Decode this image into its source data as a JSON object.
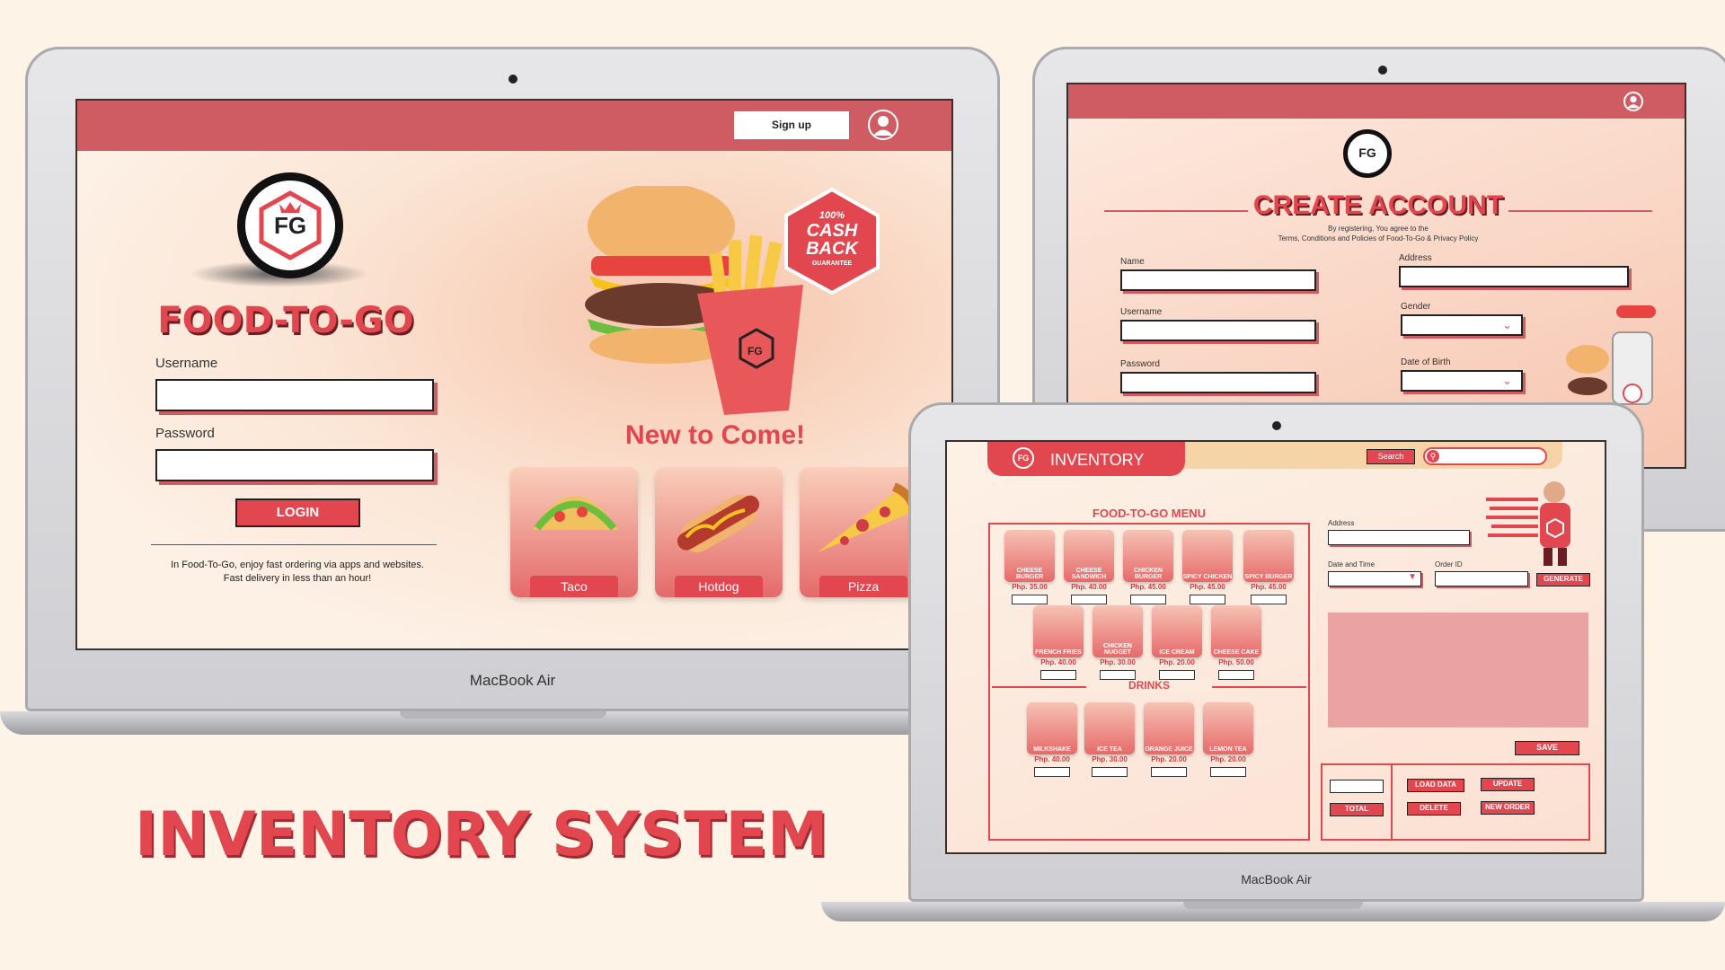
{
  "title": "INVENTORY SYSTEM",
  "laptop_brand": "MacBook Air",
  "login": {
    "signup_label": "Sign up",
    "logo_text": "FG",
    "app_name": "FOOD-TO-GO",
    "username_label": "Username",
    "password_label": "Password",
    "login_label": "LOGIN",
    "description": "In Food-To-Go, enjoy fast ordering via apps and websites. Fast delivery in less than an hour!",
    "badge_lines": [
      "100%",
      "CASH",
      "BACK",
      "GUARANTEE"
    ],
    "new_to_come": "New to Come!",
    "cards": [
      {
        "label": "Taco",
        "icon": "taco-icon"
      },
      {
        "label": "Hotdog",
        "icon": "hotdog-icon"
      },
      {
        "label": "Pizza",
        "icon": "pizza-icon"
      }
    ]
  },
  "signup": {
    "title": "CREATE ACCOUNT",
    "terms_line1": "By registering, You agree to the",
    "terms_line2": "Terms, Conditions and Policies of Food-To-Go & Privacy Policy",
    "name_label": "Name",
    "username_label": "Username",
    "password_label": "Password",
    "address_label": "Address",
    "gender_label": "Gender",
    "dob_label": "Date of Birth"
  },
  "inventory": {
    "tab_label": "INVENTORY",
    "search_label": "Search",
    "menu_title": "FOOD-TO-GO MENU",
    "drinks_title": "DRINKS",
    "foods": [
      {
        "name": "CHEESE BURGER",
        "price": "Php. 35.00"
      },
      {
        "name": "CHEESE SANDWICH",
        "price": "Php. 40.00"
      },
      {
        "name": "CHICKEN BURGER",
        "price": "Php. 45.00"
      },
      {
        "name": "SPICY CHICKEN",
        "price": "Php. 45.00"
      },
      {
        "name": "SPICY BURGER",
        "price": "Php. 45.00"
      },
      {
        "name": "FRENCH FRIES",
        "price": "Php. 40.00"
      },
      {
        "name": "CHICKEN NUGGET",
        "price": "Php. 30.00"
      },
      {
        "name": "ICE CREAM",
        "price": "Php. 20.00"
      },
      {
        "name": "CHEESE CAKE",
        "price": "Php. 50.00"
      }
    ],
    "drinks": [
      {
        "name": "MILKSHAKE",
        "price": "Php. 40.00"
      },
      {
        "name": "ICE TEA",
        "price": "Php. 30.00"
      },
      {
        "name": "ORANGE JUICE",
        "price": "Php. 20.00"
      },
      {
        "name": "LEMON TEA",
        "price": "Php. 20.00"
      }
    ],
    "address_label": "Address",
    "datetime_label": "Date and Time",
    "orderid_label": "Order ID",
    "generate_label": "GENERATE",
    "save_label": "SAVE",
    "total_label": "TOTAL",
    "load_label": "LOAD DATA",
    "update_label": "UPDATE",
    "delete_label": "DELETE",
    "new_order_label": "NEW ORDER"
  },
  "colors": {
    "accent": "#d05c63",
    "red": "#e2474f",
    "background": "#fdf3e6"
  }
}
